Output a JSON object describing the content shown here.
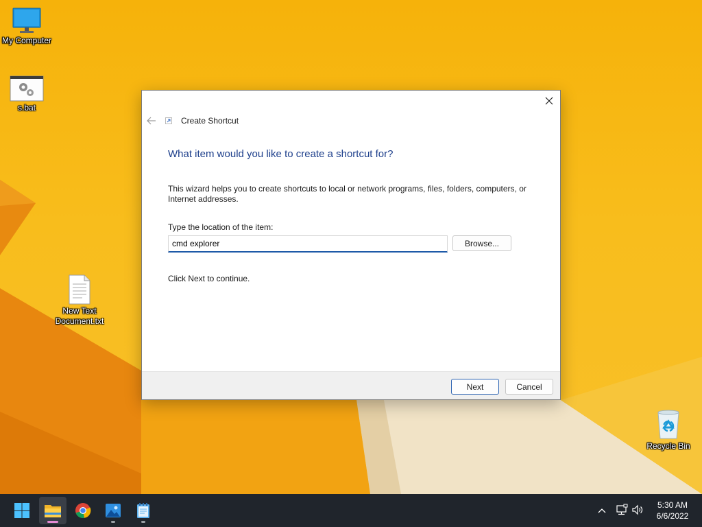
{
  "desktop": {
    "icons": [
      {
        "label": "My Computer",
        "icon": "monitor-icon"
      },
      {
        "label": "s.bat",
        "icon": "gear-batch-icon"
      },
      {
        "label": "New Text Document.txt",
        "icon": "text-document-icon"
      },
      {
        "label": "Recycle Bin",
        "icon": "recycle-bin-icon"
      }
    ]
  },
  "dialog": {
    "title": "Create Shortcut",
    "heading": "What item would you like to create a shortcut for?",
    "intro": "This wizard helps you to create shortcuts to local or network programs, files, folders, computers, or Internet addresses.",
    "location_label": "Type the location of the item:",
    "location_value": "cmd explorer",
    "browse_label": "Browse...",
    "continue_text": "Click Next to continue.",
    "next_label": "Next",
    "cancel_label": "Cancel"
  },
  "taskbar": {
    "apps": [
      {
        "name": "Start",
        "icon": "windows-start-icon"
      },
      {
        "name": "File Explorer",
        "icon": "folder-icon",
        "active": true
      },
      {
        "name": "Google Chrome",
        "icon": "chrome-icon"
      },
      {
        "name": "Photos",
        "icon": "photos-icon"
      },
      {
        "name": "Notepad",
        "icon": "notepad-icon"
      }
    ],
    "time": "5:30 AM",
    "date": "6/6/2022"
  },
  "colors": {
    "wallpaper": "#f6b20a",
    "dialog_heading": "#1b3d8a",
    "input_focus": "#1e5aa8",
    "taskbar": "#20252c"
  }
}
